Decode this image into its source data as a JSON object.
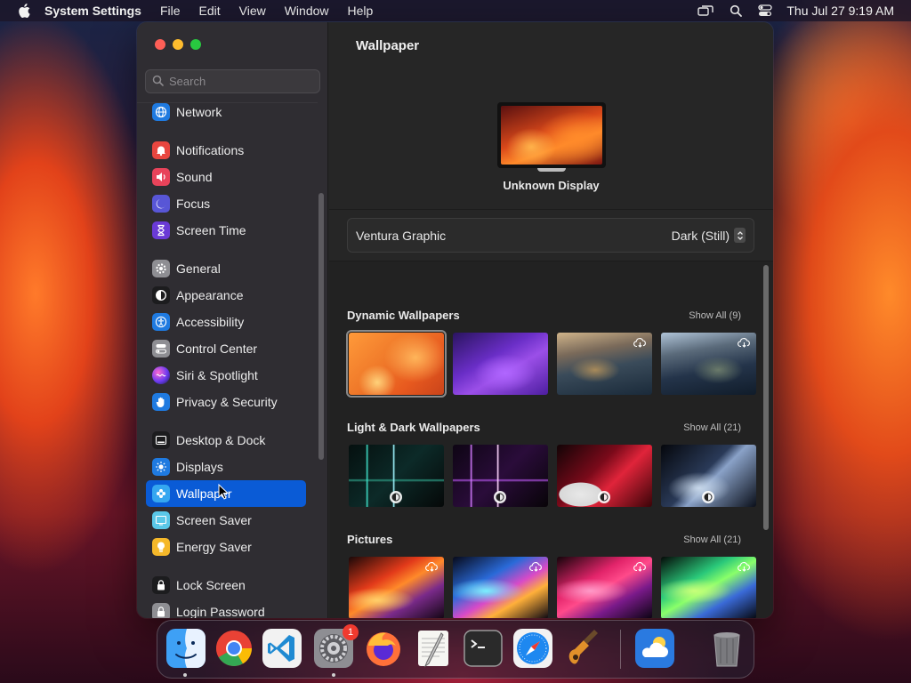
{
  "menubar": {
    "app_name": "System Settings",
    "menus": [
      "File",
      "Edit",
      "View",
      "Window",
      "Help"
    ],
    "clock": "Thu Jul 27  9:19 AM"
  },
  "window": {
    "search_placeholder": "Search",
    "sidebar": {
      "items": [
        {
          "label": "Network",
          "icon": "globe-icon",
          "color": "#1f7ae0"
        },
        {
          "label": "Notifications",
          "icon": "bell-icon",
          "color": "#e8463f"
        },
        {
          "label": "Sound",
          "icon": "speaker-icon",
          "color": "#e8435a"
        },
        {
          "label": "Focus",
          "icon": "moon-icon",
          "color": "#5856d6"
        },
        {
          "label": "Screen Time",
          "icon": "hourglass-icon",
          "color": "#6a3ad6"
        },
        {
          "label": "General",
          "icon": "gear-icon",
          "color": "#8e8e93"
        },
        {
          "label": "Appearance",
          "icon": "appearance-icon",
          "color": "#1c1c1e"
        },
        {
          "label": "Accessibility",
          "icon": "accessibility-icon",
          "color": "#1f7ae0"
        },
        {
          "label": "Control Center",
          "icon": "switches-icon",
          "color": "#8e8e93"
        },
        {
          "label": "Siri & Spotlight",
          "icon": "siri-icon",
          "color": "#c23ad6"
        },
        {
          "label": "Privacy & Security",
          "icon": "hand-icon",
          "color": "#1f7ae0"
        },
        {
          "label": "Desktop & Dock",
          "icon": "dock-icon",
          "color": "#1c1c1e"
        },
        {
          "label": "Displays",
          "icon": "sun-icon",
          "color": "#1f7ae0"
        },
        {
          "label": "Wallpaper",
          "icon": "flower-icon",
          "color": "#35a7f0",
          "selected": true
        },
        {
          "label": "Screen Saver",
          "icon": "screensaver-icon",
          "color": "#5ac8e8"
        },
        {
          "label": "Energy Saver",
          "icon": "bulb-icon",
          "color": "#f5b82a"
        },
        {
          "label": "Lock Screen",
          "icon": "lock-icon",
          "color": "#1c1c1e"
        },
        {
          "label": "Login Password",
          "icon": "lock-icon",
          "color": "#8e8e93"
        }
      ]
    },
    "content": {
      "title": "Wallpaper",
      "display_name": "Unknown Display",
      "current_wallpaper": "Ventura Graphic",
      "appearance_value": "Dark (Still)",
      "sections": [
        {
          "title": "Dynamic Wallpapers",
          "show_all": "Show All (9)",
          "thumbs": [
            "ventura",
            "monterey",
            "catalina-day",
            "catalina-dusk"
          ]
        },
        {
          "title": "Light & Dark Wallpapers",
          "show_all": "Show All (21)",
          "thumbs": [
            "macos-teal",
            "macos-purple",
            "macos-red",
            "macos-blue"
          ]
        },
        {
          "title": "Pictures",
          "show_all": "Show All (21)",
          "thumbs": [
            "swirl-orange",
            "swirl-blue",
            "swirl-pink",
            "swirl-green"
          ]
        }
      ]
    }
  },
  "dock": {
    "apps": [
      "finder",
      "chrome",
      "vscode",
      "system-settings",
      "firefox",
      "textedit",
      "terminal",
      "safari",
      "garageband",
      "weather",
      "trash"
    ],
    "settings_badge": "1"
  },
  "colors": {
    "accent": "#0a5bd6",
    "window_bg": "#262626",
    "sidebar_bg": "#2f2d32"
  }
}
